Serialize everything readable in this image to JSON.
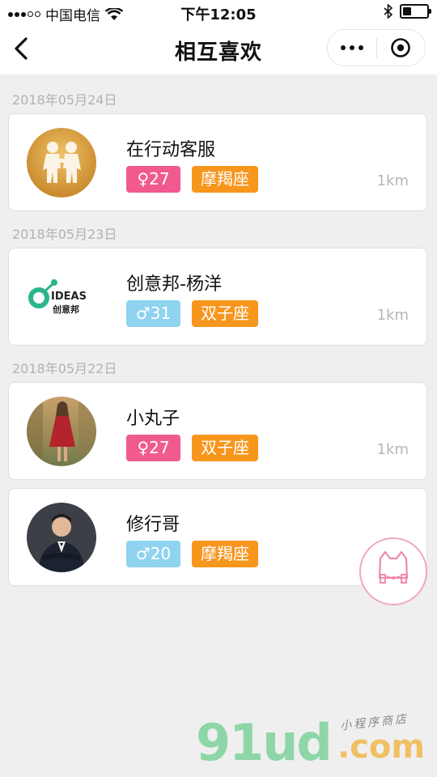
{
  "status_bar": {
    "carrier": "中国电信",
    "time": "下午12:05"
  },
  "nav": {
    "title": "相互喜欢"
  },
  "groups": [
    {
      "date": "2018年05月24日",
      "items": [
        {
          "name": "在行动客服",
          "gender_symbol": "♀",
          "age": "27",
          "gender": "female",
          "zodiac": "摩羯座",
          "distance": "1km",
          "avatar": "paper-figures-avatar"
        }
      ]
    },
    {
      "date": "2018年05月23日",
      "items": [
        {
          "name": "创意邦-杨洋",
          "gender_symbol": "♂",
          "age": "31",
          "gender": "male",
          "zodiac": "双子座",
          "distance": "1km",
          "avatar": "ideas-logo-avatar",
          "logo_text": "IDEAS",
          "logo_subtext": "创意邦"
        }
      ]
    },
    {
      "date": "2018年05月22日",
      "items": [
        {
          "name": "小丸子",
          "gender_symbol": "♀",
          "age": "27",
          "gender": "female",
          "zodiac": "双子座",
          "distance": "1km",
          "avatar": "woman-red-dress-avatar"
        },
        {
          "name": "修行哥",
          "gender_symbol": "♂",
          "age": "20",
          "gender": "male",
          "zodiac": "摩羯座",
          "distance": "",
          "avatar": "man-suit-avatar"
        }
      ]
    }
  ],
  "watermark": {
    "main": "91ud",
    "suffix": ".com",
    "subtitle": "小程序商店"
  },
  "colors": {
    "female_tag": "#f05a8f",
    "male_tag": "#8fd3ef",
    "zodiac_tag": "#f7961d"
  }
}
